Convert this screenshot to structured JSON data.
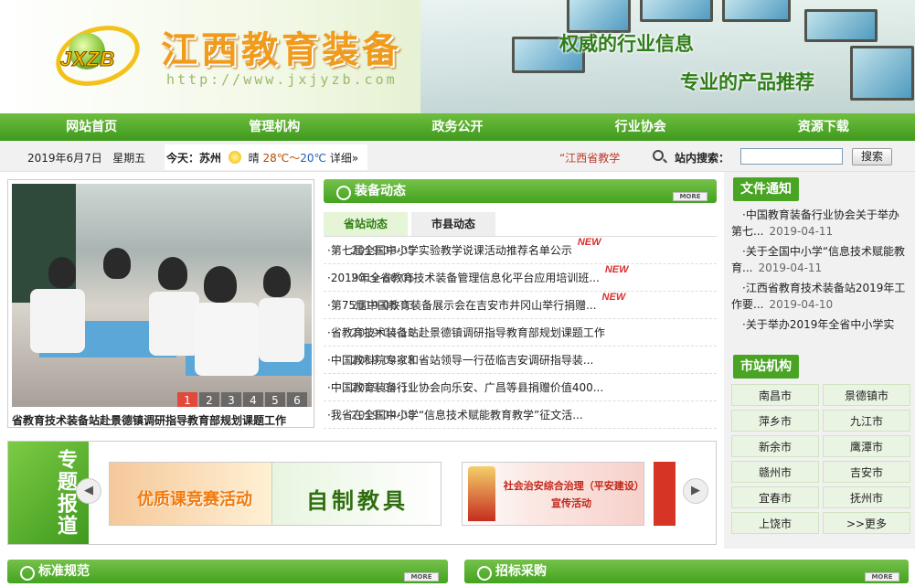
{
  "header": {
    "logo_text": "JXZB",
    "title": "江西教育装备",
    "url": "http://www.jxjyzb.com",
    "slogan_1": "权威的行业信息",
    "slogan_2": "专业的产品推荐"
  },
  "nav": [
    "网站首页",
    "管理机构",
    "政务公开",
    "行业协会",
    "资源下载"
  ],
  "infobar": {
    "date": "2019年6月7日   星期五",
    "weather_prefix": "今天：苏州",
    "weather_state": "晴",
    "temp_hi": "28℃～",
    "temp_lo": "20℃",
    "weather_more": "详细»",
    "marquee": "“江西省教学",
    "search_label": "站内搜索：",
    "search_value": "",
    "search_button": "搜索"
  },
  "slideshow": {
    "caption": "省教育技术装备站赴景德镇调研指导教育部规划课题工作",
    "pages": [
      "1",
      "2",
      "3",
      "4",
      "5",
      "6"
    ],
    "active_page": "1"
  },
  "news": {
    "title": "装备动态",
    "more": "MORE",
    "tabs": [
      "省站动态",
      "市县动态"
    ],
    "items": [
      {
        "title": "第七届全国中小学实验教学说课活动推荐名单公示",
        "new": "NEW",
        "date": "2019-06-05"
      },
      {
        "title": "2019年全省教育技术装备管理信息化平台应用培训班...",
        "new": "NEW",
        "date": "2019-06-05"
      },
      {
        "title": "第75届中国教育装备展示会在吉安市井冈山举行捐赠...",
        "new": "NEW",
        "date": "2019-06-03"
      },
      {
        "title": "省教育技术装备站赴景德镇调研指导教育部规划课题工作",
        "new": "",
        "date": "2019-04-18"
      },
      {
        "title": "中国教科院专家和省站领导一行莅临吉安调研指导装...",
        "new": "",
        "date": "2019-04-18"
      },
      {
        "title": "中国教育装备行业协会向乐安、广昌等县捐赠价值400...",
        "new": "",
        "date": "2019-04-11"
      },
      {
        "title": "我省在全国中小学“信息技术赋能教育教学”征文活...",
        "new": "",
        "date": "2019-04-08"
      }
    ]
  },
  "notices": {
    "title": "文件通知",
    "items": [
      {
        "title": "中国教育装备行业协会关于举办第七...",
        "date": "2019-04-11"
      },
      {
        "title": "关于全国中小学“信息技术赋能教育...",
        "date": "2019-04-11"
      },
      {
        "title": "江西省教育技术装备站2019年工作要...",
        "date": "2019-04-10"
      },
      {
        "title": "关于举办2019年全省中小学实",
        "date": ""
      }
    ]
  },
  "cities": {
    "title": "市站机构",
    "items": [
      "南昌市",
      "景德镇市",
      "萍乡市",
      "九江市",
      "新余市",
      "鹰潭市",
      "赣州市",
      "吉安市",
      "宜春市",
      "抚州市",
      "上饶市",
      ">>更多"
    ]
  },
  "topics": {
    "label": "专题报道",
    "banners": [
      "优质课竞赛活动",
      "自制教具",
      "社会治安综合治理（平安建设）宣传活动"
    ]
  },
  "bottom": {
    "left_title": "标准规范",
    "right_title": "招标采购",
    "more": "MORE"
  },
  "colors": {
    "brand_green": "#43a320",
    "title_orange": "#f29a1a",
    "new_badge": "#d93030"
  }
}
